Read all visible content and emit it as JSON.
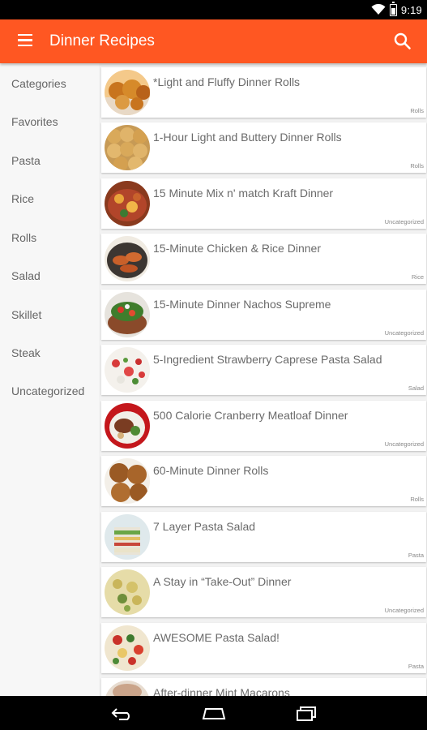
{
  "status": {
    "time": "9:19"
  },
  "appbar": {
    "title": "Dinner Recipes"
  },
  "sidebar": {
    "items": [
      {
        "label": "Categories"
      },
      {
        "label": "Favorites"
      },
      {
        "label": "Pasta"
      },
      {
        "label": "Rice"
      },
      {
        "label": "Rolls"
      },
      {
        "label": "Salad"
      },
      {
        "label": "Skillet"
      },
      {
        "label": "Steak"
      },
      {
        "label": "Uncategorized"
      }
    ]
  },
  "recipes": [
    {
      "title": "*Light and Fluffy Dinner Rolls",
      "category": "Rolls"
    },
    {
      "title": "1-Hour Light and Buttery Dinner Rolls",
      "category": "Rolls"
    },
    {
      "title": "15 Minute Mix n' match Kraft Dinner",
      "category": "Uncategorized"
    },
    {
      "title": "15-Minute Chicken & Rice Dinner",
      "category": "Rice"
    },
    {
      "title": "15-Minute Dinner Nachos Supreme",
      "category": "Uncategorized"
    },
    {
      "title": "5-Ingredient Strawberry Caprese Pasta Salad",
      "category": "Salad"
    },
    {
      "title": "500 Calorie Cranberry Meatloaf Dinner",
      "category": "Uncategorized"
    },
    {
      "title": "60-Minute Dinner Rolls",
      "category": "Rolls"
    },
    {
      "title": "7 Layer Pasta Salad",
      "category": "Pasta"
    },
    {
      "title": "A Stay in “Take-Out” Dinner",
      "category": "Uncategorized"
    },
    {
      "title": "AWESOME Pasta Salad!",
      "category": "Pasta"
    },
    {
      "title": "After-dinner Mint Macarons",
      "category": ""
    }
  ],
  "colors": {
    "accent": "#ff5722",
    "statusbar": "#000000",
    "background": "#f2f2f2"
  },
  "icons": {
    "menu": "hamburger-menu-icon",
    "search": "search-icon",
    "back": "back-icon",
    "home": "home-icon",
    "recents": "recents-icon"
  }
}
